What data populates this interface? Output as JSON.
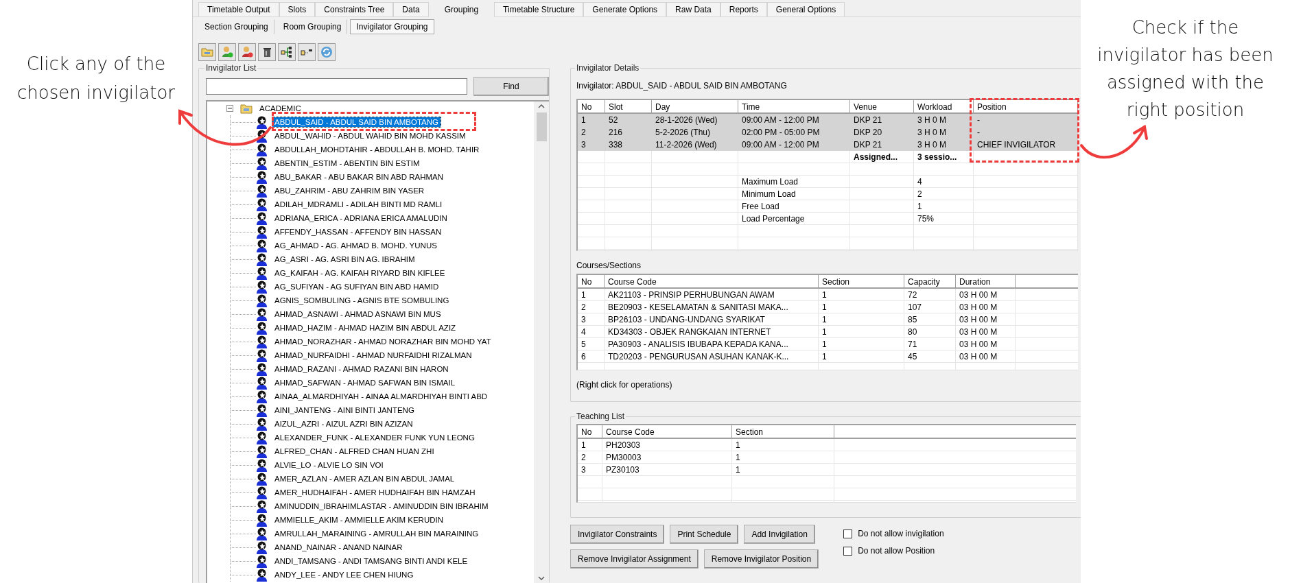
{
  "left_note": "Click any of the chosen invigilator",
  "right_note": "Check if the invigilator has been assigned with the right position",
  "tabs": [
    {
      "label": "Timetable Output",
      "selected": false
    },
    {
      "label": "Slots",
      "selected": false
    },
    {
      "label": "Constraints Tree",
      "selected": false
    },
    {
      "label": "Data",
      "selected": false
    },
    {
      "label": "Grouping",
      "selected": true
    },
    {
      "label": "Timetable Structure",
      "selected": false
    },
    {
      "label": "Generate Options",
      "selected": false
    },
    {
      "label": "Raw Data",
      "selected": false
    },
    {
      "label": "Reports",
      "selected": false
    },
    {
      "label": "General Options",
      "selected": false
    }
  ],
  "sub_tabs": [
    {
      "label": "Section Grouping",
      "selected": false
    },
    {
      "label": "Room Grouping",
      "selected": false
    },
    {
      "label": "Invigilator Grouping",
      "selected": true
    }
  ],
  "invigilator_list": {
    "title": "Invigilator List",
    "find_button": "Find",
    "tree": {
      "label": "ACADEMIC",
      "expanded": true,
      "children": [
        {
          "label": "ABDUL_SAID - ABDUL SAID BIN AMBOTANG",
          "selected": true
        },
        {
          "label": "ABDUL_WAHID - ABDUL WAHID BIN MOHD KASSIM",
          "selected": false
        },
        {
          "label": "ABDULLAH_MOHDTAHIR - ABDULLAH B. MOHD. TAHIR",
          "selected": false
        },
        {
          "label": "ABENTIN_ESTIM - ABENTIN BIN ESTIM",
          "selected": false
        },
        {
          "label": "ABU_BAKAR - ABU BAKAR BIN ABD RAHMAN",
          "selected": false
        },
        {
          "label": "ABU_ZAHRIM - ABU ZAHRIM BIN YASER",
          "selected": false
        },
        {
          "label": "ADILAH_MDRAMLI - ADILAH BINTI MD RAMLI",
          "selected": false
        },
        {
          "label": "ADRIANA_ERICA - ADRIANA ERICA AMALUDIN",
          "selected": false
        },
        {
          "label": "AFFENDY_HASSAN - AFFENDY BIN HASSAN",
          "selected": false
        },
        {
          "label": "AG_AHMAD - AG. AHMAD B. MOHD. YUNUS",
          "selected": false
        },
        {
          "label": "AG_ASRI - AG. ASRI BIN AG. IBRAHIM",
          "selected": false
        },
        {
          "label": "AG_KAIFAH - AG. KAIFAH RIYARD BIN KIFLEE",
          "selected": false
        },
        {
          "label": "AG_SUFIYAN - AG SUFIYAN BIN ABD HAMID",
          "selected": false
        },
        {
          "label": "AGNIS_SOMBULING - AGNIS BTE SOMBULING",
          "selected": false
        },
        {
          "label": "AHMAD_ASNAWI - AHMAD ASNAWI BIN MUS",
          "selected": false
        },
        {
          "label": "AHMAD_HAZIM - AHMAD HAZIM BIN ABDUL AZIZ",
          "selected": false
        },
        {
          "label": "AHMAD_NORAZHAR - AHMAD NORAZHAR BIN MOHD YAT",
          "selected": false
        },
        {
          "label": "AHMAD_NURFAIDHI - AHMAD NURFAIDHI RIZALMAN",
          "selected": false
        },
        {
          "label": "AHMAD_RAZANI - AHMAD RAZANI BIN HARON",
          "selected": false
        },
        {
          "label": "AHMAD_SAFWAN - AHMAD SAFWAN BIN ISMAIL",
          "selected": false
        },
        {
          "label": "AINAA_ALMARDHIYAH - AINAA ALMARDHIYAH BINTI ABD",
          "selected": false
        },
        {
          "label": "AINI_JANTENG - AINI BINTI JANTENG",
          "selected": false
        },
        {
          "label": "AIZUL_AZRI - AIZUL AZRI BIN AZIZAN",
          "selected": false
        },
        {
          "label": "ALEXANDER_FUNK - ALEXANDER FUNK YUN LEONG",
          "selected": false
        },
        {
          "label": "ALFRED_CHAN - ALFRED CHAN HUAN ZHI",
          "selected": false
        },
        {
          "label": "ALVIE_LO - ALVIE LO SIN VOI",
          "selected": false
        },
        {
          "label": "AMER_AZLAN - AMER AZLAN BIN ABDUL JAMAL",
          "selected": false
        },
        {
          "label": "AMER_HUDHAIFAH - AMER HUDHAIFAH BIN HAMZAH",
          "selected": false
        },
        {
          "label": "AMINUDDIN_IBRAHIMLASTAR - AMINUDDIN BIN  IBRAHIM",
          "selected": false
        },
        {
          "label": "AMMIELLE_AKIM - AMMIELLE AKIM KERUDIN",
          "selected": false
        },
        {
          "label": "AMRULLAH_MARAINING - AMRULLAH BIN MARAINING",
          "selected": false
        },
        {
          "label": "ANAND_NAINAR - ANAND NAINAR",
          "selected": false
        },
        {
          "label": "ANDI_TAMSANG - ANDI TAMSANG BINTI ANDI KELE",
          "selected": false
        },
        {
          "label": "ANDY_LEE - ANDY LEE CHEN HIUNG",
          "selected": false
        }
      ]
    }
  },
  "invigilator_details": {
    "title": "Invigilator Details",
    "invigilator": "Invigilator: ABDUL_SAID - ABDUL SAID BIN AMBOTANG",
    "columns": [
      "No",
      "Slot",
      "Day",
      "Time",
      "Venue",
      "Workload",
      "Position"
    ],
    "rows": [
      {
        "cells": [
          "1",
          "52",
          "28-1-2026 (Wed)",
          "09:00 AM - 12:00 PM",
          "DKP 21",
          "3 H 0 M",
          "-"
        ],
        "highlighted": true
      },
      {
        "cells": [
          "2",
          "216",
          "5-2-2026 (Thu)",
          "02:00 PM - 05:00 PM",
          "DKP 20",
          "3 H 0 M",
          "-"
        ],
        "highlighted": true
      },
      {
        "cells": [
          "3",
          "338",
          "11-2-2026 (Wed)",
          "09:00 AM - 12:00 PM",
          "DKP 21",
          "3 H 0 M",
          "CHIEF INVIGILATOR"
        ],
        "highlighted": true
      }
    ],
    "summary": {
      "venue": "Assigned...",
      "workload": "3 sessio..."
    },
    "loads": [
      {
        "label": "Maximum Load",
        "value": "4"
      },
      {
        "label": "Minimum Load",
        "value": "2"
      },
      {
        "label": "Free Load",
        "value": "1"
      },
      {
        "label": "Load Percentage",
        "value": "75%"
      }
    ]
  },
  "courses": {
    "title": "Courses/Sections",
    "columns": [
      "No",
      "Course Code",
      "Section",
      "Capacity",
      "Duration"
    ],
    "rows": [
      [
        "1",
        "AK21103 - PRINSIP PERHUBUNGAN AWAM",
        "1",
        "72",
        "03 H 00 M"
      ],
      [
        "2",
        "BE20903 - KESELAMATAN & SANITASI MAKA...",
        "1",
        "107",
        "03 H 00 M"
      ],
      [
        "3",
        "BP26103 - UNDANG-UNDANG SYARIKAT",
        "1",
        "85",
        "03 H 00 M"
      ],
      [
        "4",
        "KD34303 - OBJEK RANGKAIAN INTERNET",
        "1",
        "80",
        "03 H 00 M"
      ],
      [
        "5",
        "PA30903 - ANALISIS IBUBAPA KEPADA KANA...",
        "1",
        "71",
        "03 H 00 M"
      ],
      [
        "6",
        "TD20203 - PENGURUSAN ASUHAN KANAK-K...",
        "1",
        "45",
        "03 H 00 M"
      ]
    ],
    "hint": "(Right click for operations)"
  },
  "teaching_list": {
    "title": "Teaching List",
    "columns": [
      "No",
      "Course Code",
      "Section"
    ],
    "rows": [
      [
        "1",
        "PH20303",
        "1"
      ],
      [
        "2",
        "PM30003",
        "1"
      ],
      [
        "3",
        "PZ30103",
        "1"
      ]
    ]
  },
  "buttons": [
    [
      "Invigilator Constraints",
      "Print Schedule",
      "Add Invigilation"
    ],
    [
      "Remove Invigilator Assignment",
      "Remove Invigilator Position"
    ]
  ],
  "checkboxes": [
    {
      "label": "Do not allow invigilation",
      "checked": false
    },
    {
      "label": "Do not allow Position",
      "checked": false
    }
  ]
}
